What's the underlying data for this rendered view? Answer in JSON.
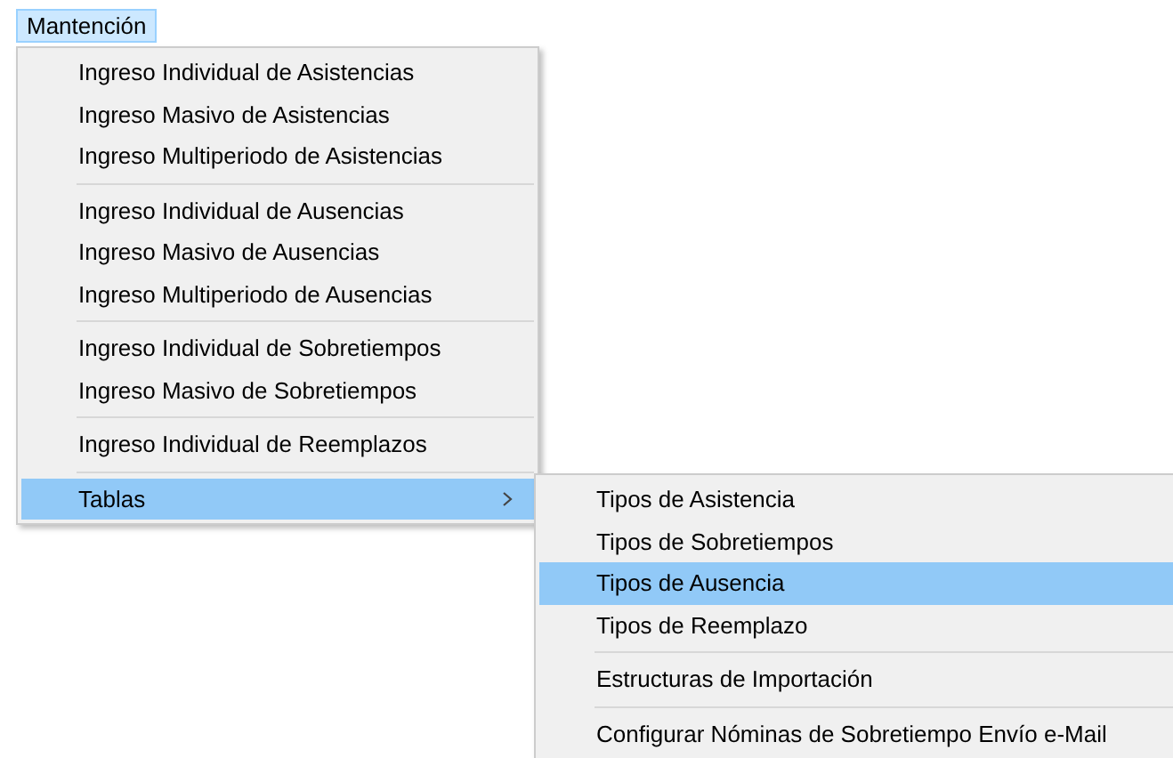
{
  "menubar": [
    {
      "label": "Mantención",
      "selected": true
    }
  ],
  "menu": {
    "groups": [
      [
        {
          "label": "Ingreso Individual de Asistencias",
          "selected": false,
          "has_submenu": false
        },
        {
          "label": "Ingreso Masivo de Asistencias",
          "selected": false,
          "has_submenu": false
        },
        {
          "label": "Ingreso Multiperiodo de Asistencias",
          "selected": false,
          "has_submenu": false
        }
      ],
      [
        {
          "label": "Ingreso Individual de Ausencias",
          "selected": false,
          "has_submenu": false
        },
        {
          "label": "Ingreso Masivo de Ausencias",
          "selected": false,
          "has_submenu": false
        },
        {
          "label": "Ingreso Multiperiodo de Ausencias",
          "selected": false,
          "has_submenu": false
        }
      ],
      [
        {
          "label": "Ingreso Individual de Sobretiempos",
          "selected": false,
          "has_submenu": false
        },
        {
          "label": "Ingreso Masivo de Sobretiempos",
          "selected": false,
          "has_submenu": false
        }
      ],
      [
        {
          "label": "Ingreso Individual de Reemplazos",
          "selected": false,
          "has_submenu": false
        }
      ],
      [
        {
          "label": "Tablas",
          "selected": true,
          "has_submenu": true
        }
      ]
    ]
  },
  "submenu": {
    "groups": [
      [
        {
          "label": "Tipos de Asistencia",
          "selected": false,
          "has_submenu": false
        },
        {
          "label": "Tipos de Sobretiempos",
          "selected": false,
          "has_submenu": false
        },
        {
          "label": "Tipos de Ausencia",
          "selected": true,
          "has_submenu": false
        },
        {
          "label": "Tipos de Reemplazo",
          "selected": false,
          "has_submenu": false
        }
      ],
      [
        {
          "label": "Estructuras de Importación",
          "selected": false,
          "has_submenu": false
        }
      ],
      [
        {
          "label": "Configurar Nóminas de Sobretiempo Envío e-Mail",
          "selected": false,
          "has_submenu": false
        }
      ]
    ]
  }
}
